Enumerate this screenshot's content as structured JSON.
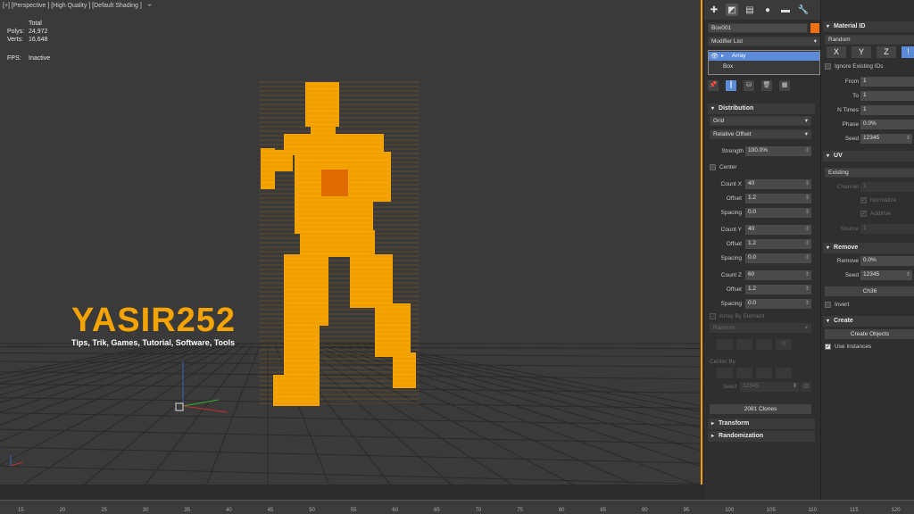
{
  "viewport": {
    "label": "[+] [Perspective ] [High Quality ] [Default Shading ]",
    "filter_icon": "funnel-icon",
    "stats": {
      "total_header": "Total",
      "polys_label": "Polys:",
      "polys_value": "24,972",
      "verts_label": "Verts:",
      "verts_value": "16,648",
      "fps_label": "FPS:",
      "fps_value": "Inactive"
    },
    "watermark": {
      "title": "YASIR252",
      "subtitle": "Tips, Trik, Games, Tutorial, Software, Tools"
    },
    "figure_color": "#f5a300"
  },
  "command_panel": {
    "tabs": [
      "create-tab-icon",
      "modify-tab-icon",
      "hierarchy-tab-icon",
      "motion-tab-icon",
      "display-tab-icon",
      "utilities-tab-icon"
    ],
    "object_name": "Box001",
    "object_color": "#f07010",
    "modifier_list": "Modifier List",
    "stack": [
      "Array",
      "Box"
    ],
    "distribution": {
      "title": "Distribution",
      "mode": "Grid",
      "offset_mode": "Relative Offset",
      "strength_label": "Strength",
      "strength_value": "100.0%",
      "center_label": "Center",
      "count_x_label": "Count X",
      "count_x": "40",
      "offset_label": "Offset",
      "offset_x": "1.2",
      "spacing_label": "Spacing",
      "spacing_x": "0.0",
      "count_y_label": "Count Y",
      "count_y": "40",
      "offset_y": "1.2",
      "spacing_y": "0.0",
      "count_z_label": "Count Z",
      "count_z": "60",
      "offset_z": "1.2",
      "spacing_z": "0.0",
      "array_by_element": "Array By Element",
      "random_dd": "Random",
      "center_by": "Center By",
      "seed_label": "Seed",
      "seed_value": "12345",
      "clones_button": "2081 Clones"
    },
    "transform_title": "Transform",
    "randomization_title": "Randomization"
  },
  "extra_panel": {
    "material_title": "Material ID",
    "material_mode": "Random",
    "axis_buttons": [
      "X",
      "Y",
      "Z",
      "!"
    ],
    "ignore_existing": "Ignore Existing IDs",
    "from_label": "From",
    "from_value": "1",
    "to_label": "To",
    "to_value": "1",
    "ntimes_label": "N Times",
    "ntimes_value": "1",
    "phase_label": "Phase",
    "phase_value": "0.0%",
    "seed_label": "Seed",
    "seed_value": "12345",
    "uv_title": "UV",
    "uv_mode": "Existing",
    "channel_label": "Channel",
    "channel_value": "1",
    "normalize": "Normalize",
    "additive": "Additive",
    "source_label": "Source",
    "source_value": "1",
    "remove_title": "Remove",
    "remove_label": "Remove",
    "remove_value": "0.0%",
    "remove_seed_label": "Seed",
    "remove_seed_value": "12345",
    "ch_button": "Ch36",
    "invert": "Invert",
    "create_title": "Create",
    "create_objects": "Create Objects",
    "use_instances": "Use Instances"
  },
  "timeline": {
    "ticks": [
      "15",
      "20",
      "25",
      "30",
      "35",
      "40",
      "45",
      "50",
      "55",
      "60",
      "65",
      "70",
      "75",
      "80",
      "85",
      "90",
      "95",
      "100",
      "105",
      "110",
      "115",
      "120"
    ]
  }
}
